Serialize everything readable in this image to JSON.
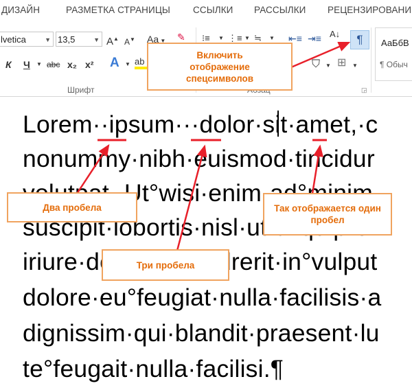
{
  "ribbon": {
    "tabs": [
      "ДИЗАЙН",
      "РАЗМЕТКА СТРАНИЦЫ",
      "ССЫЛКИ",
      "РАССЫЛКИ",
      "РЕЦЕНЗИРОВАНИ"
    ],
    "font_name": "lvetica",
    "font_size": "13,5",
    "grow_font": "A",
    "shrink_font": "A",
    "change_case": "Aa",
    "bold": "К",
    "underline": "Ч",
    "strikethrough": "abc",
    "subscript": "x₂",
    "superscript": "x²",
    "text_effects": "A",
    "sort": "A↓",
    "show_marks": "¶",
    "group_font": "Шрифт",
    "group_paragraph": "Абзац",
    "style_sample": "АаБбВ",
    "style_normal": "¶ Обыч"
  },
  "document": {
    "lines": [
      "Lorem··ipsum···dolor·sit·amet,·c",
      "nonummy·nibh·euismod·tincidur",
      "volutpat.·Ut°wisi·enim·ad°minim",
      "suscipit·lobortis·nisl·ut·aliquip·ex",
      "iriure·dolor·in·hendrerit·in°vulput",
      "dolore·eu°feugiat·nulla·facilisis·a",
      "dignissim·qui·blandit·praesent·lu",
      "te°feugait·nulla·facilisi.¶"
    ]
  },
  "callouts": {
    "show_marks": "Включить отображение спецсимволов",
    "two_spaces": "Два пробела",
    "three_spaces": "Три пробела",
    "one_space": "Так отображается один пробел"
  },
  "colors": {
    "accent": "#e46c0a",
    "callout_border": "#f0a35e",
    "arrow": "#e8202a",
    "underline": "#e8202a"
  }
}
